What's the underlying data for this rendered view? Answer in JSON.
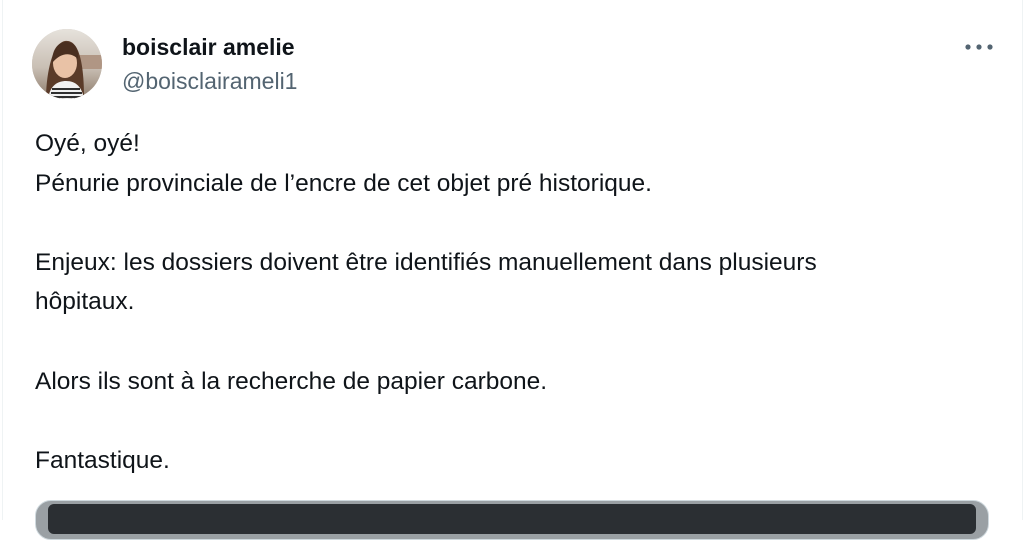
{
  "tweet": {
    "author": {
      "name": "boisclair amelie",
      "handle": "@boisclairameli1"
    },
    "more_icon": "more-horizontal-icon",
    "text_lines": [
      "Oyé, oyé!",
      "Pénurie provinciale de l’encre de cet objet pré historique.",
      "",
      "Enjeux: les dossiers doivent être identifiés manuellement dans plusieurs",
      "hôpitaux.",
      "",
      "Alors ils sont à la recherche de papier carbone.",
      "",
      "Fantastique."
    ]
  },
  "colors": {
    "text_primary": "#0f1419",
    "text_secondary": "#536471",
    "border": "#eff3f4"
  }
}
